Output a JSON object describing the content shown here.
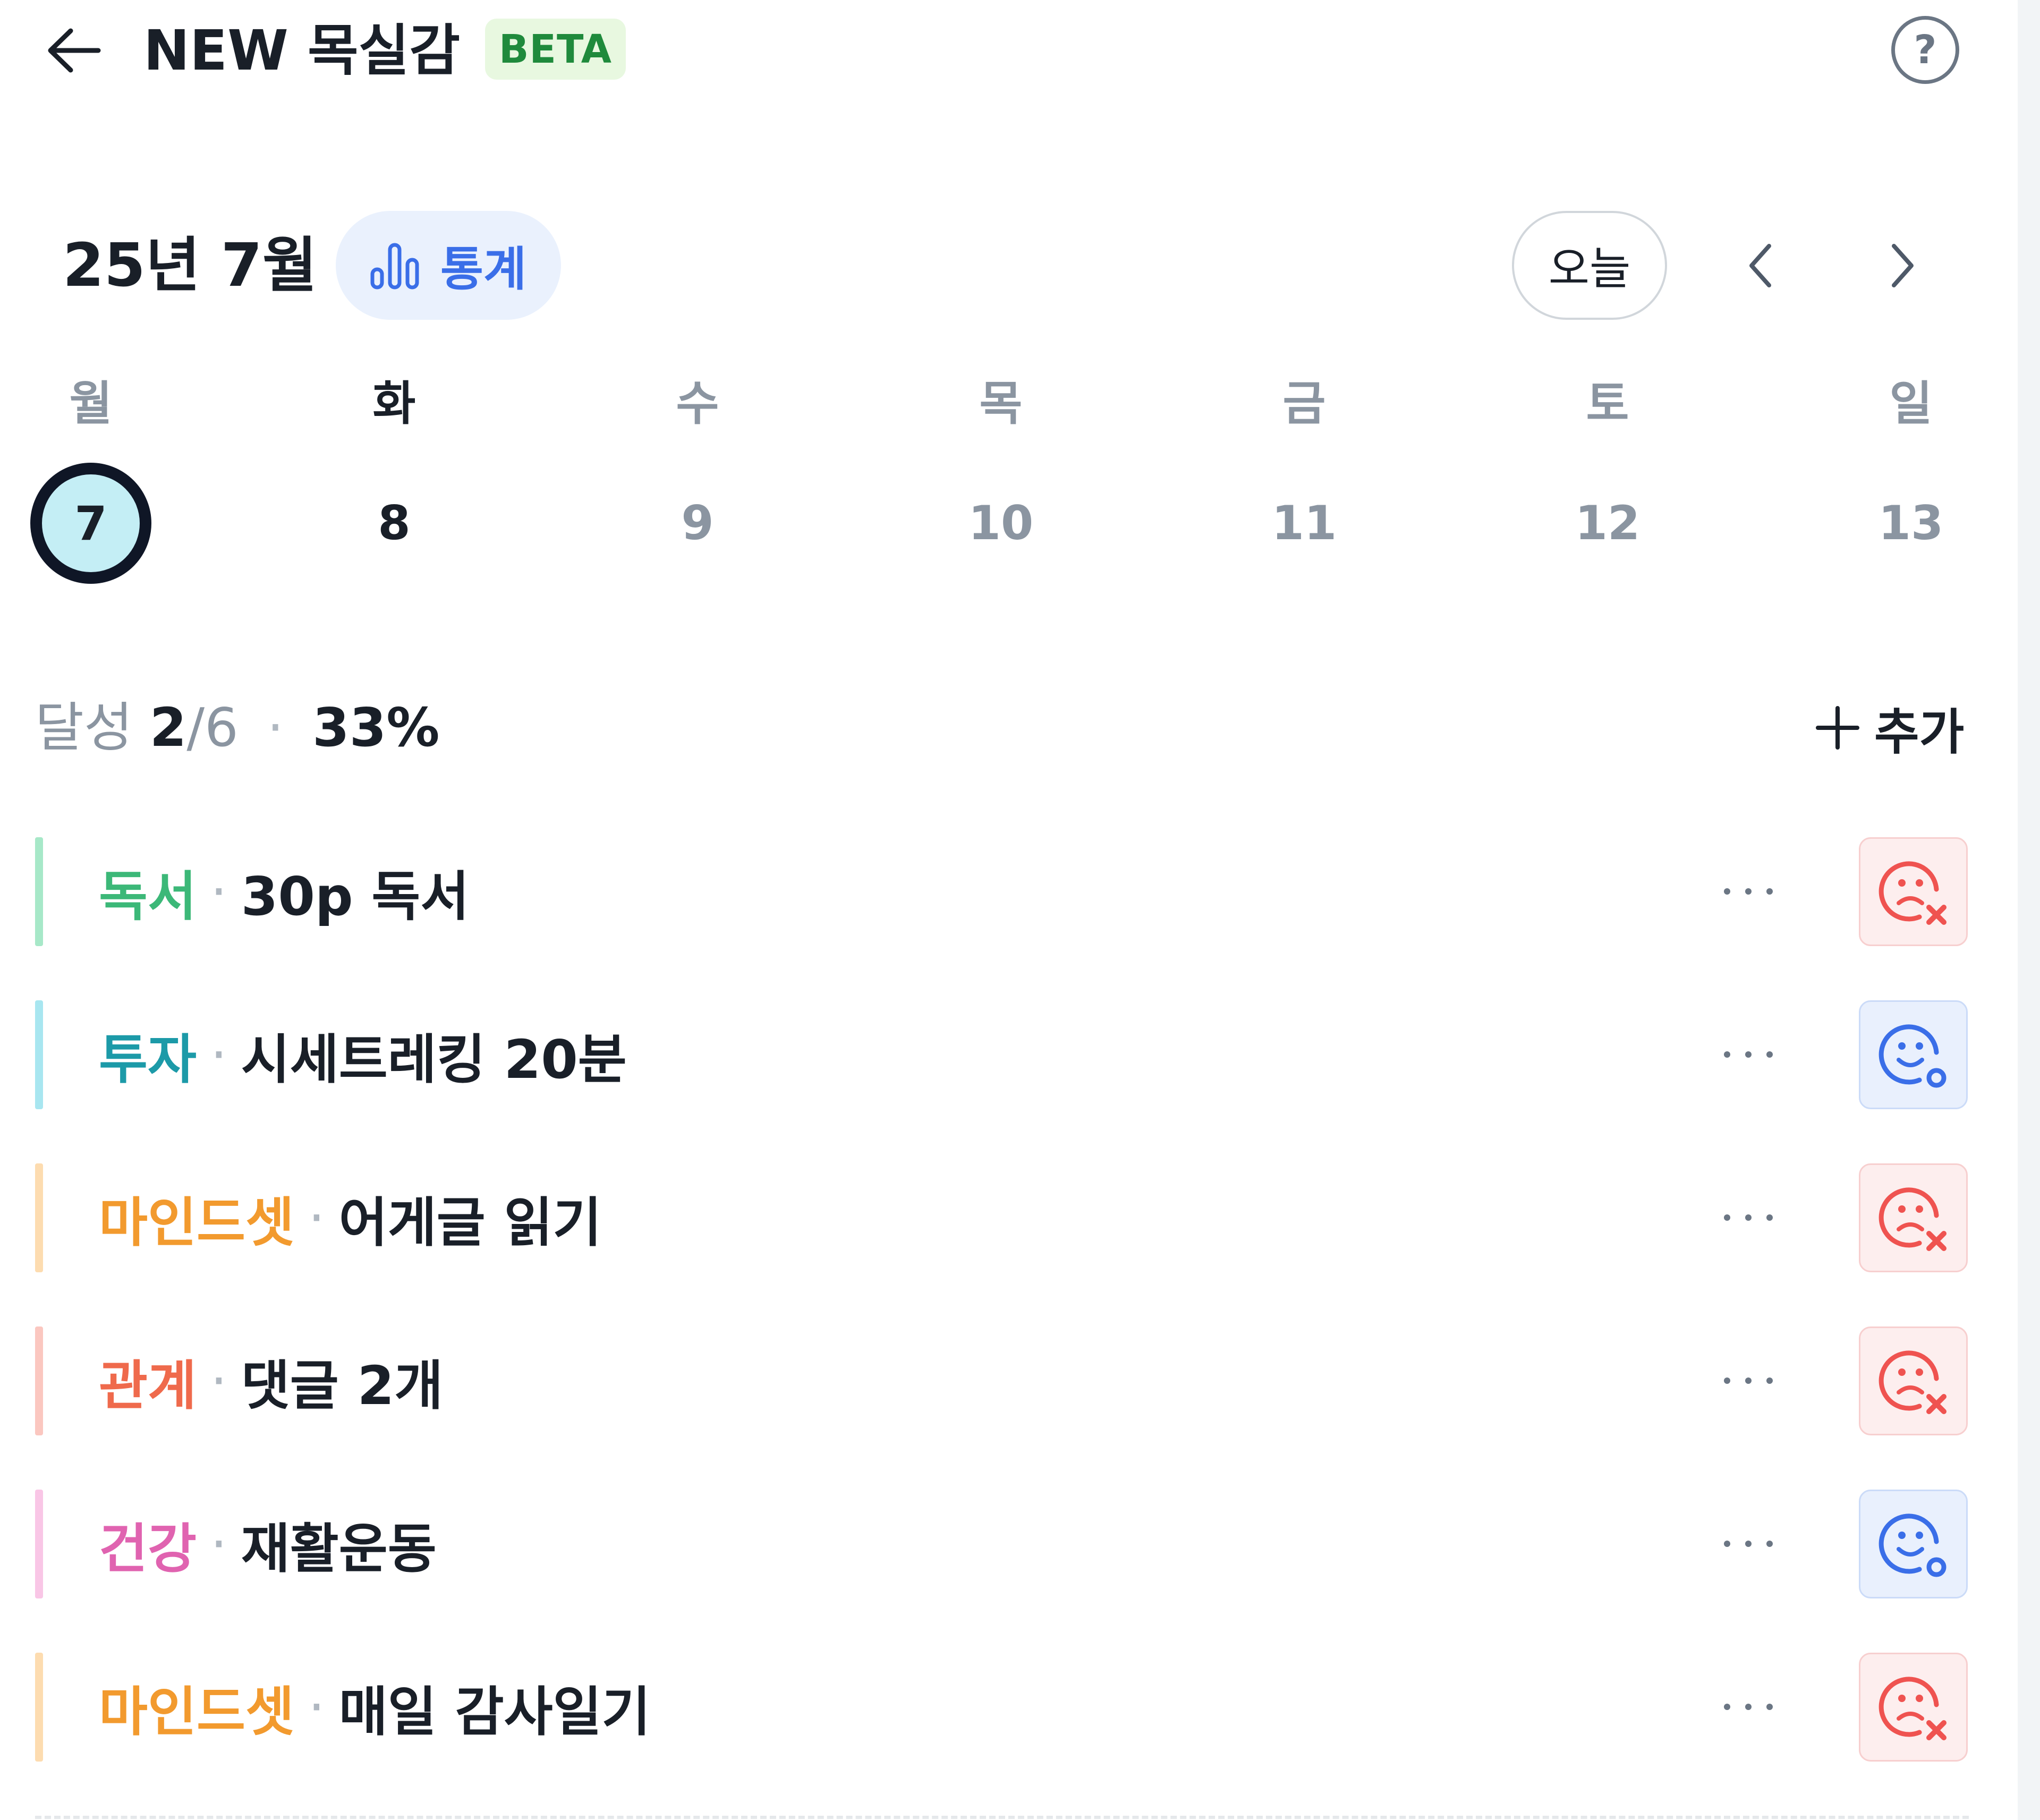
{
  "header": {
    "back_icon": "arrow-left-icon",
    "title": "NEW 목실감",
    "badge": "BETA",
    "help_icon": "question-circle-icon",
    "help_glyph": "?"
  },
  "calendar": {
    "month_label": "25년 7월",
    "stats_label": "통계",
    "stats_icon": "bar-chart-icon",
    "today_label": "오늘",
    "prev_icon": "chevron-left-icon",
    "next_icon": "chevron-right-icon",
    "weekdays": [
      "월",
      "화",
      "수",
      "목",
      "금",
      "토",
      "일"
    ],
    "days": [
      "7",
      "8",
      "9",
      "10",
      "11",
      "12",
      "13"
    ],
    "selected_day": "7"
  },
  "progress": {
    "label": "달성",
    "done": "2",
    "total": "/6",
    "separator": "·",
    "percent": "33%"
  },
  "add_button": {
    "icon": "plus-icon",
    "label": "추가"
  },
  "habits": [
    {
      "category": "독서",
      "name": "30p 독서",
      "color": "#3cb878",
      "bar_color": "#a7e8c8",
      "status": "fail",
      "status_icon": "sad-face-x-icon"
    },
    {
      "category": "투자",
      "name": "시세트레킹 20분",
      "color": "#1c9aa8",
      "bar_color": "#a8e6f0",
      "status": "pending",
      "status_icon": "smile-face-circle-icon"
    },
    {
      "category": "마인드셋",
      "name": "어게글 읽기",
      "color": "#f29a2e",
      "bar_color": "#fddcb0",
      "status": "fail",
      "status_icon": "sad-face-x-icon"
    },
    {
      "category": "관계",
      "name": "댓글 2개",
      "color": "#ef6a4c",
      "bar_color": "#fbc7c0",
      "status": "fail",
      "status_icon": "sad-face-x-icon"
    },
    {
      "category": "건강",
      "name": "재활운동",
      "color": "#e063b0",
      "bar_color": "#f9c6e6",
      "status": "pending",
      "status_icon": "smile-face-circle-icon"
    },
    {
      "category": "마인드셋",
      "name": "매일 감사일기",
      "color": "#f29a2e",
      "bar_color": "#fddcb0",
      "status": "fail",
      "status_icon": "sad-face-x-icon"
    }
  ],
  "colors": {
    "fail_icon": "#ef5350",
    "pending_icon": "#3a6ee8",
    "accent_blue": "#3a6ee8",
    "selected_day_bg": "#c4eef5"
  }
}
